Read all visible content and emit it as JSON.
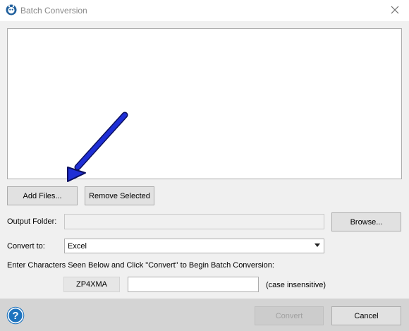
{
  "window": {
    "title": "Batch Conversion",
    "app_icon": "app-logo-icon",
    "close_icon": "close-icon"
  },
  "file_list": {
    "items": []
  },
  "buttons": {
    "add_files": "Add Files...",
    "remove_selected": "Remove Selected",
    "browse": "Browse...",
    "convert": "Convert",
    "cancel": "Cancel"
  },
  "output_folder": {
    "label": "Output Folder:",
    "value": ""
  },
  "convert_to": {
    "label": "Convert to:",
    "selected": "Excel"
  },
  "captcha": {
    "instruction": "Enter Characters Seen Below and Click \"Convert\" to Begin Batch Conversion:",
    "code": "ZP4XMA",
    "input_value": "",
    "hint": "(case insensitive)"
  },
  "footer": {
    "help_icon": "help-icon"
  },
  "annotation": {
    "arrow_color": "#1f2fd6"
  },
  "colors": {
    "help_blue": "#1e73be",
    "bottom_bar": "#d4d4d4"
  }
}
